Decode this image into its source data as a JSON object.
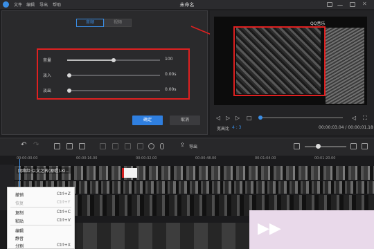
{
  "titlebar": {
    "menus": [
      "文件",
      "编辑",
      "导出",
      "帮助"
    ],
    "title": "未命名"
  },
  "editor": {
    "tabs": [
      "音频",
      "视频"
    ],
    "active_tab": "音频",
    "settings": [
      {
        "label": "音量",
        "value": "100",
        "level": 0.5
      },
      {
        "label": "淡入",
        "value": "0.00s",
        "level": 0.0
      },
      {
        "label": "淡出",
        "value": "0.00s",
        "level": 0.0
      }
    ],
    "ok_label": "确定",
    "cancel_label": "取消"
  },
  "preview": {
    "brand_text": "QQ音乐",
    "aspect_label": "宽高比",
    "aspect_value": "4 : 3",
    "time_readout": "00:00:03.04 / 00:00:01.18",
    "progress": 0.0
  },
  "toolbar": {
    "export_label": "导出"
  },
  "timeline": {
    "ruler": [
      "00:00:00.00",
      "00:00:16.00",
      "00:00:32.00",
      "00:00:48.00",
      "00:01:04.00",
      "00:01:20.00"
    ],
    "clip_title": "网络红·以文之名(原唱)-Ki..."
  },
  "context_menu": {
    "items": [
      {
        "label": "撤销",
        "shortcut": "Ctrl+Z",
        "disabled": false
      },
      {
        "label": "恢复",
        "shortcut": "Ctrl+Y",
        "disabled": true
      },
      {
        "label": "复制",
        "shortcut": "Ctrl+C",
        "disabled": false
      },
      {
        "label": "粘贴",
        "shortcut": "Ctrl+V",
        "disabled": false
      },
      {
        "label": "编辑",
        "shortcut": "",
        "disabled": false
      },
      {
        "label": "静音",
        "shortcut": "",
        "disabled": false
      },
      {
        "label": "分割",
        "shortcut": "Ctrl+X",
        "disabled": false
      }
    ]
  },
  "colors": {
    "accent": "#3a8ee6",
    "highlight": "#e02020",
    "background": "#1e1e20"
  }
}
